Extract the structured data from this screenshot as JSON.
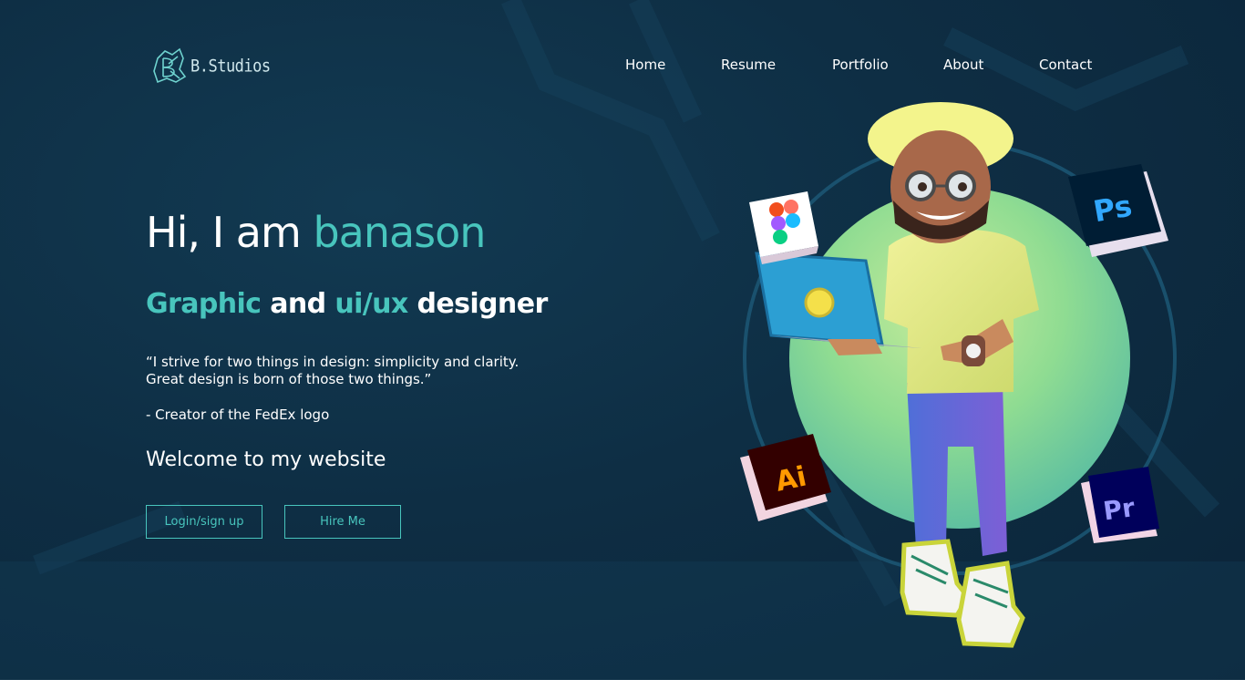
{
  "brand": {
    "logo_text": "B.Studios"
  },
  "nav": {
    "items": [
      "Home",
      "Resume",
      "Portfolio",
      "About",
      "Contact"
    ]
  },
  "hero": {
    "greeting": "Hi, I am ",
    "name": "banason",
    "role_word1": "Graphic",
    "role_and": " and ",
    "role_word2": "ui/ux",
    "role_tail": " designer",
    "quote_line1": "“I strive for two things in design: simplicity and clarity.",
    "quote_line2": "Great design is born of those two things.”",
    "quote_author": "- Creator of the FedEx logo",
    "welcome": "Welcome to my website"
  },
  "buttons": {
    "login_label": "Login/sign up",
    "hire_label": "Hire Me"
  },
  "app_icons": {
    "ps": "Ps",
    "ai": "Ai",
    "pr": "Pr"
  },
  "colors": {
    "accent": "#48c5bd",
    "background": "#0e2e44"
  }
}
